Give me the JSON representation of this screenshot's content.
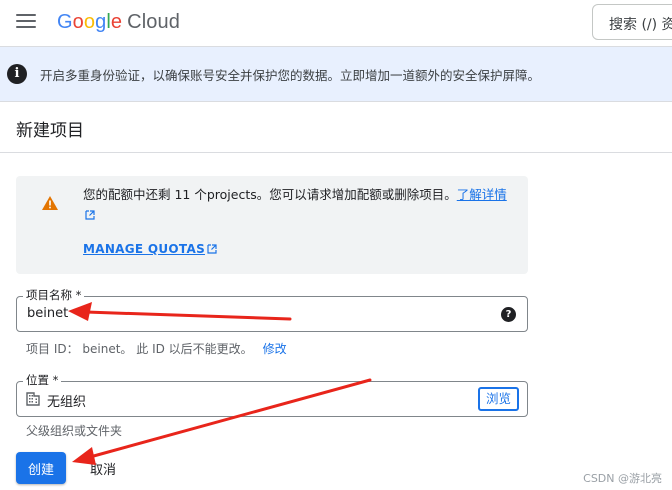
{
  "header": {
    "logo_parts": [
      "G",
      "o",
      "o",
      "g",
      "l",
      "e"
    ],
    "logo_suffix": "Cloud",
    "search_label": "搜索 (/) 资"
  },
  "banner": {
    "icon": "info-icon",
    "text": "开启多重身份验证，以确保账号安全并保护您的数据。立即增加一道额外的安全保护屏障。"
  },
  "page": {
    "title": "新建项目"
  },
  "quota": {
    "icon": "warning-icon",
    "text": "您的配额中还剩 11 个projects。您可以请求增加配额或删除项目。",
    "learn_more": "了解详情",
    "manage_link": "MANAGE QUOTAS"
  },
  "project_name": {
    "label": "项目名称 *",
    "value": "beinet",
    "id_line": "项目 ID： beinet。 此 ID 以后不能更改。",
    "edit_link": "修改"
  },
  "location": {
    "label": "位置 *",
    "value": "无组织",
    "browse_label": "浏览",
    "hint": "父级组织或文件夹"
  },
  "actions": {
    "create_label": "创建",
    "cancel_label": "取消"
  },
  "watermark": "CSDN @游北亮",
  "colors": {
    "accent": "#1a73e8",
    "banner_bg": "#e8f0fe",
    "warning": "#e37400",
    "annotation_arrow": "#e8251b"
  }
}
